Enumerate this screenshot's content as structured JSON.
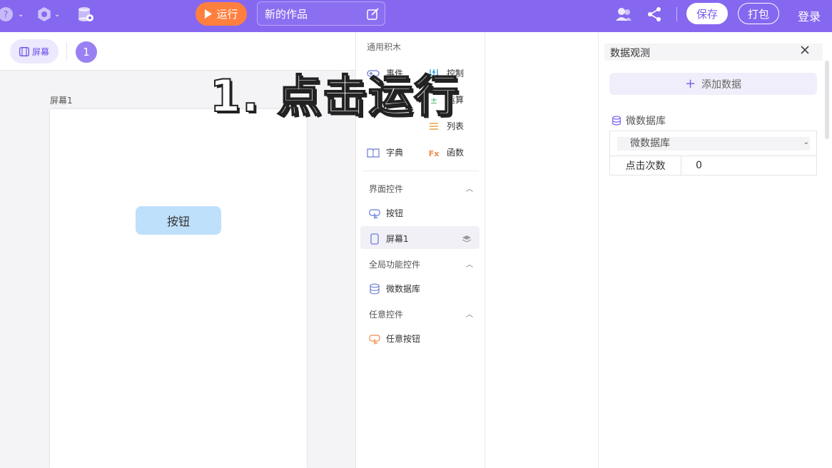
{
  "topbar": {
    "run_label": "运行",
    "project_title": "新的作品",
    "save_label": "保存",
    "pack_label": "打包",
    "login_label": "登录",
    "icons": [
      "help-icon",
      "settings-icon",
      "database-icon",
      "users-icon",
      "share-icon",
      "edit-icon",
      "play-icon"
    ]
  },
  "canvas": {
    "screen_tab_label": "屏幕",
    "screen_number": "1",
    "screen_name": "屏幕1",
    "button_label": "按钮"
  },
  "blocks": {
    "section_title": "通用积木",
    "items": [
      {
        "label": "事件",
        "icon": "event-icon"
      },
      {
        "label": "控制",
        "icon": "control-icon"
      },
      {
        "label": "运算",
        "icon": "operation-icon"
      },
      {
        "label": "列表",
        "icon": "list-icon"
      },
      {
        "label": "字典",
        "icon": "dictionary-icon"
      },
      {
        "label": "函数",
        "icon": "function-icon"
      }
    ],
    "groups": [
      {
        "label": "界面控件",
        "items": [
          {
            "label": "按钮"
          },
          {
            "label": "屏幕1"
          }
        ]
      },
      {
        "label": "全局功能控件",
        "items": [
          {
            "label": "微数据库"
          }
        ]
      },
      {
        "label": "任意控件",
        "items": [
          {
            "label": "任意按钮"
          }
        ]
      }
    ]
  },
  "data_panel": {
    "title": "数据观测",
    "add_label": "添加数据",
    "db_label": "微数据库",
    "select_value": "微数据库",
    "row_key": "点击次数",
    "row_value": "0"
  },
  "overlay_text": "1. 点击运行",
  "colors": {
    "topbar": "#8667f0",
    "run_button": "#ff7f3f",
    "accent": "#7a5cf0",
    "button_fill": "#bfe0fb"
  }
}
